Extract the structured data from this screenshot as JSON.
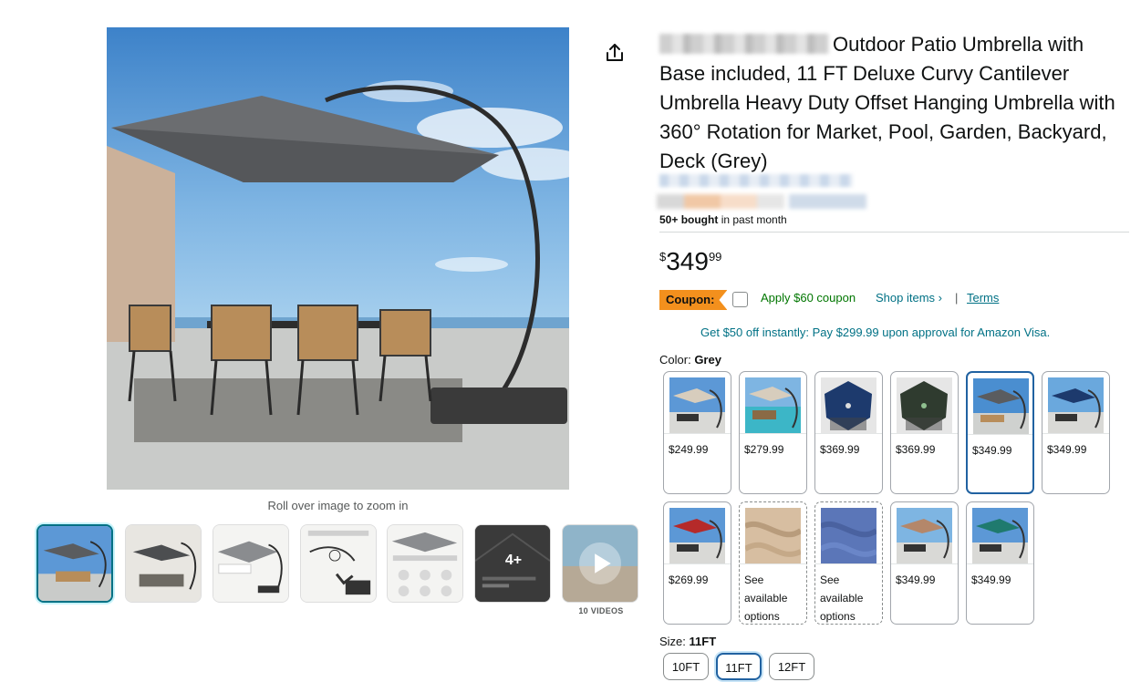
{
  "product": {
    "title": "Outdoor Patio Umbrella with Base included, 11 FT Deluxe Curvy Cantilever Umbrella Heavy Duty Offset Hanging Umbrella with 360° Rotation for Market, Pool, Garden, Backyard, Deck (Grey)",
    "bought_count": "50+ bought",
    "bought_suffix": "in past month"
  },
  "gallery": {
    "zoom_hint": "Roll over image to zoom in",
    "extra_count": "4+",
    "videos_label": "10 VIDEOS"
  },
  "price": {
    "symbol": "$",
    "whole": "349",
    "fraction": "99"
  },
  "coupon": {
    "badge": "Coupon:",
    "apply": "Apply $60 coupon",
    "shop_items": "Shop items ›",
    "separator": "|",
    "terms": "Terms"
  },
  "visa_offer": "Get $50 off instantly: Pay $299.99 upon approval for Amazon Visa.",
  "color": {
    "label": "Color:",
    "selected": "Grey",
    "options": [
      {
        "price": "$249.99"
      },
      {
        "price": "$279.99"
      },
      {
        "price": "$369.99"
      },
      {
        "price": "$369.99"
      },
      {
        "price": "$349.99"
      },
      {
        "price": "$349.99"
      },
      {
        "price": "$269.99"
      },
      {
        "price": "See available options"
      },
      {
        "price": "See available options"
      },
      {
        "price": "$349.99"
      },
      {
        "price": "$349.99"
      }
    ]
  },
  "size": {
    "label": "Size:",
    "selected": "11FT",
    "options": [
      "10FT",
      "11FT",
      "12FT"
    ]
  },
  "colors": {
    "link": "#007185",
    "coupon_green": "#007600",
    "coupon_badge": "#f3901d",
    "selected_border": "#2162a1"
  }
}
